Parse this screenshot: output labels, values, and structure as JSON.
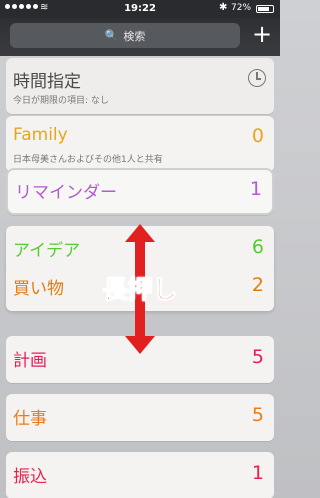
{
  "status": {
    "time": "19:22",
    "battery_text": "72%"
  },
  "search": {
    "placeholder": "検索"
  },
  "header": {
    "add_label": "+"
  },
  "time_card": {
    "title": "時間指定",
    "subtitle": "今日が期限の項目: なし"
  },
  "family": {
    "title": "Family",
    "count": "0",
    "subtitle": "日本母美さんおよびその他1人と共有"
  },
  "lists": [
    {
      "name": "リマインダー",
      "count": "1",
      "color": "#b45bd0"
    },
    {
      "name": "アイデア",
      "count": "6",
      "color": "#55cc33"
    },
    {
      "name": "買い物",
      "count": "2",
      "color": "#e57b12"
    },
    {
      "name": "計画",
      "count": "5",
      "color": "#e51e5a"
    },
    {
      "name": "仕事",
      "count": "5",
      "color": "#ee7a18"
    },
    {
      "name": "振込",
      "count": "1",
      "color": "#e5234e"
    }
  ],
  "annotation": {
    "label": "長押し",
    "color": "#ff1d1d"
  }
}
